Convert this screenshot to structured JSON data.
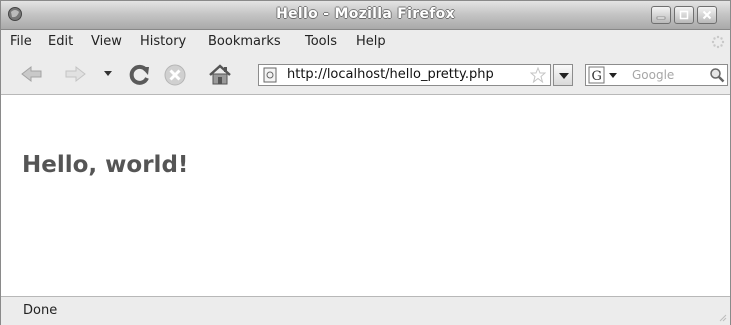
{
  "window": {
    "title": "Hello - Mozilla Firefox"
  },
  "menubar": {
    "items": [
      "File",
      "Edit",
      "View",
      "History",
      "Bookmarks",
      "Tools",
      "Help"
    ]
  },
  "navigation": {
    "icons": [
      "back-arrow-icon",
      "forward-arrow-icon",
      "history-dropdown-icon",
      "reload-icon",
      "stop-icon",
      "home-icon"
    ],
    "url": "http://localhost/hello_pretty.php",
    "search_placeholder": "Google",
    "search_engine_letter": "G"
  },
  "content": {
    "heading": "Hello, world!"
  },
  "statusbar": {
    "status": "Done"
  },
  "colors": {
    "heading": "#555555",
    "chrome": "#ececec",
    "titlebar_text": "#ffffff"
  }
}
